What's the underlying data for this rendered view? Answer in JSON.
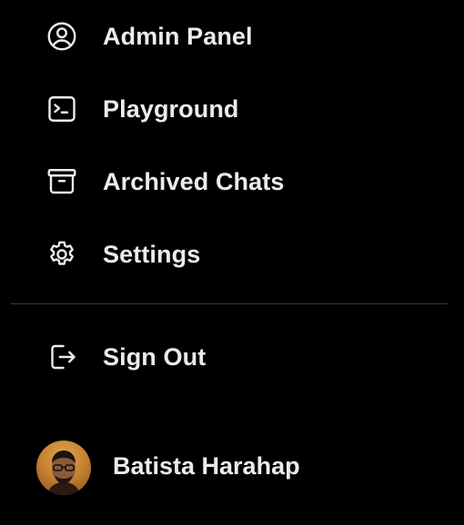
{
  "menu": {
    "items": [
      {
        "label": "Admin Panel",
        "icon": "user-circle-icon"
      },
      {
        "label": "Playground",
        "icon": "terminal-icon"
      },
      {
        "label": "Archived Chats",
        "icon": "archive-box-icon"
      },
      {
        "label": "Settings",
        "icon": "gear-icon"
      }
    ],
    "sign_out": {
      "label": "Sign Out",
      "icon": "sign-out-icon"
    }
  },
  "user": {
    "name": "Batista Harahap",
    "avatar": "avatar"
  },
  "colors": {
    "background": "#000000",
    "text": "#ececec",
    "divider": "#3a3a3a"
  }
}
